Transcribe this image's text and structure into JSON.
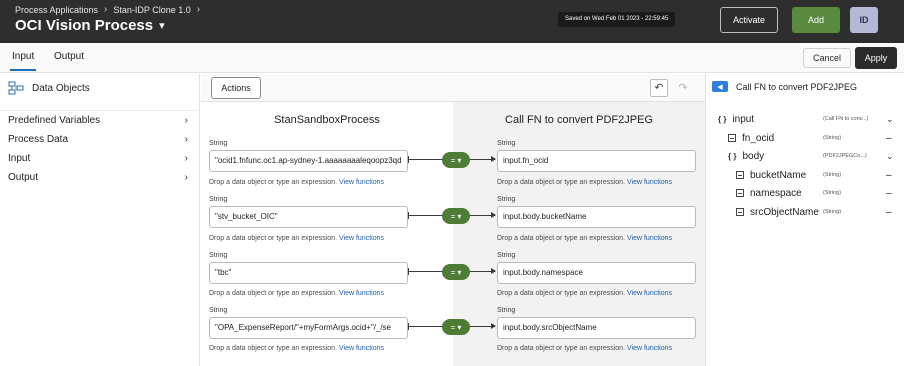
{
  "header": {
    "breadcrumbs": [
      "Process Applications",
      "Stan-IDP Clone 1.0"
    ],
    "separator": "›",
    "title": "OCI Vision Process",
    "saved_text": "Saved on Wed Feb 01 2023 - 22:59:45",
    "activate_label": "Activate",
    "add_label": "Add",
    "avatar_initials": "ID",
    "accent_green": "#5a8a3f"
  },
  "tabs": [
    {
      "label": "Input",
      "active": true
    },
    {
      "label": "Output",
      "active": false
    }
  ],
  "actions": {
    "cancel_label": "Cancel",
    "apply_label": "Apply"
  },
  "left_panel": {
    "title": "Data Objects",
    "items": [
      {
        "label": "Predefined Variables",
        "icon": "chevron-right-icon"
      },
      {
        "label": "Process Data",
        "icon": "chevron-right-icon"
      },
      {
        "label": "Input",
        "icon": "chevron-right-icon"
      },
      {
        "label": "Output",
        "icon": "chevron-right-icon"
      }
    ]
  },
  "mapper": {
    "actions_label": "Actions",
    "undo_icon": "undo-icon",
    "redo_icon": "redo-icon",
    "source_title": "StanSandboxProcess",
    "target_title": "Call FN to convert PDF2JPEG",
    "hint_text": "Drop a data object or type an expression.",
    "hint_link": "View functions",
    "pill_symbol": "=",
    "pill_chevron": "▾",
    "rows": [
      {
        "source_type": "String",
        "source_value": "\"ocid1.fnfunc.oc1.ap-sydney-1.aaaaaaaaleqoopz3qd",
        "target_type": "String",
        "target_value": "input.fn_ocid"
      },
      {
        "source_type": "String",
        "source_value": "\"stv_bucket_OIC\"",
        "target_type": "String",
        "target_value": "input.body.bucketName"
      },
      {
        "source_type": "String",
        "source_value": "\"tbc\"",
        "target_type": "String",
        "target_value": "input.body.namespace"
      },
      {
        "source_type": "String",
        "source_value": "\"OPA_ExpenseReport/\"+myFormArgs.ocid+\"/_/se",
        "target_type": "String",
        "target_value": "input.body.srcObjectName"
      }
    ]
  },
  "right_panel": {
    "badge": "◀",
    "title": "Call FN to convert PDF2JPEG",
    "tree": [
      {
        "name": "input",
        "type": "(Call FN to conv...)",
        "icon": "braces-icon",
        "control": "⌄"
      },
      {
        "name": "fn_ocid",
        "type": "(String)",
        "icon": "string-field-icon",
        "control": "–"
      },
      {
        "name": "body",
        "type": "(PDF2JPEGCo...)",
        "icon": "braces-icon",
        "control": "⌄"
      },
      {
        "name": "bucketName",
        "type": "(String)",
        "icon": "string-field-icon",
        "control": "–"
      },
      {
        "name": "namespace",
        "type": "(String)",
        "icon": "string-field-icon",
        "control": "–"
      },
      {
        "name": "srcObjectName",
        "type": "(String)",
        "icon": "string-field-icon",
        "control": "–"
      }
    ]
  }
}
